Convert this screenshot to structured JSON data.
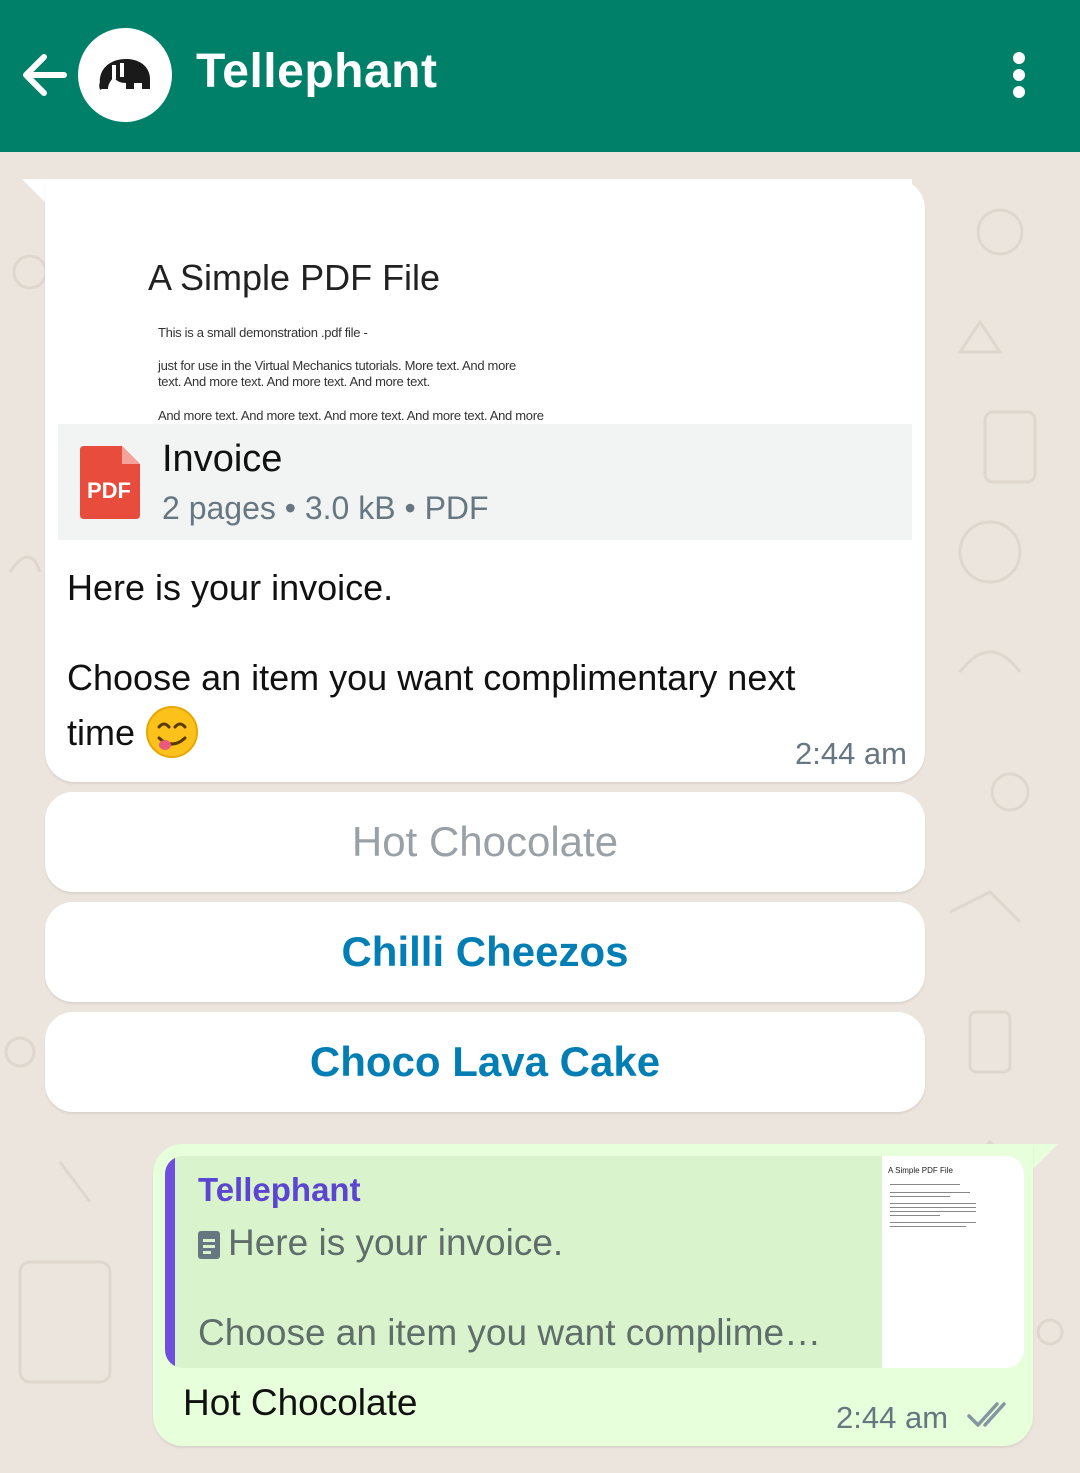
{
  "header": {
    "title": "Tellephant",
    "back_icon": "arrow-left-icon",
    "menu_icon": "more-vert-icon",
    "color": "#008069"
  },
  "incoming": {
    "preview": {
      "title": "A Simple PDF File",
      "lines": [
        "This is a small demonstration .pdf file -",
        "just for use in the Virtual Mechanics tutorials. More text. And more",
        "text. And more text. And more text. And more text.",
        "And more text. And more text. And more text. And more text. And more"
      ]
    },
    "document": {
      "icon_label": "PDF",
      "name": "Invoice",
      "meta": "2 pages • 3.0 kB • PDF"
    },
    "text_line1": "Here is your invoice.",
    "text_line2": "Choose an item you want complimentary next time",
    "emoji": "😋",
    "time": "2:44 am"
  },
  "quick_replies": [
    {
      "label": "Hot Chocolate",
      "state": "disabled"
    },
    {
      "label": "Chilli Cheezos",
      "state": "active"
    },
    {
      "label": "Choco Lava Cake",
      "state": "active"
    }
  ],
  "outgoing": {
    "quote_author": "Tellephant",
    "quote_line1": "Here is your invoice.",
    "quote_line2": "Choose an item you want complime…",
    "quote_thumb_title": "A Simple PDF File",
    "text": "Hot Chocolate",
    "time": "2:44 am",
    "status_icon": "double-check-icon"
  },
  "colors": {
    "accent_link": "#027eb5",
    "outgoing_bubble": "#e7ffdb",
    "quote_bar": "#6f4fdf",
    "pdf_red": "#e74c3c"
  }
}
